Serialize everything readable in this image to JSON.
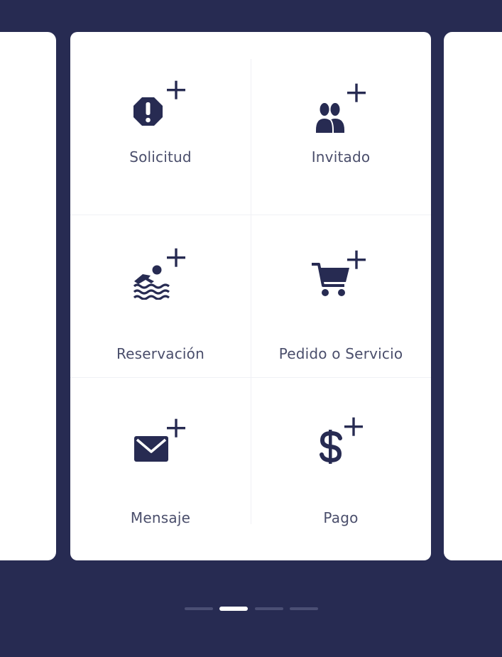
{
  "colors": {
    "background": "#272b52",
    "card": "#ffffff",
    "icon": "#272b52",
    "label": "#4a4e6b",
    "dot_inactive": "#4b4f74",
    "dot_active": "#ffffff"
  },
  "actions": [
    {
      "label": "Solicitud",
      "icon": "octagon-exclamation-plus-icon"
    },
    {
      "label": "Invitado",
      "icon": "users-plus-icon"
    },
    {
      "label": "Reservación",
      "icon": "swimmer-plus-icon"
    },
    {
      "label": "Pedido o Servicio",
      "icon": "cart-plus-icon"
    },
    {
      "label": "Mensaje",
      "icon": "envelope-plus-icon"
    },
    {
      "label": "Pago",
      "icon": "dollar-plus-icon"
    }
  ],
  "pager": {
    "total": 4,
    "active_index": 1
  }
}
